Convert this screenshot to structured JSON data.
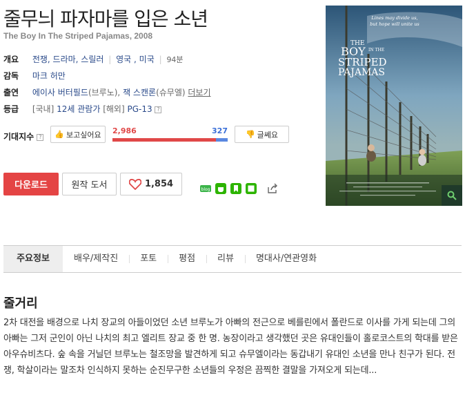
{
  "movie": {
    "title": "줄무늬 파자마를 입은 소년",
    "subtitle": "The Boy In The Striped Pajamas, 2008"
  },
  "info": {
    "overview_label": "개요",
    "genres": "전쟁, 드라마, 스릴러",
    "countries": "영국 , 미국",
    "runtime": "94분",
    "director_label": "감독",
    "director": "마크 허만",
    "cast_label": "출연",
    "cast_1": "에이사 버터필드",
    "cast_1_role": "(브루노),",
    "cast_2": "잭 스캔론",
    "cast_2_role": "(슈무엘)",
    "more_link": "더보기",
    "rating_label": "등급",
    "domestic_label": "[국내]",
    "domestic_rating": "12세 관람가",
    "overseas_label": "[해외]",
    "overseas_rating": "PG-13"
  },
  "expectation": {
    "label": "기대지수",
    "want_label": "보고싶어요",
    "dislike_label": "글쎄요",
    "want_count": "2,986",
    "dislike_count": "327",
    "want_ratio": 0.901
  },
  "actions": {
    "download": "다운로드",
    "book": "원작 도서",
    "likes": "1,854"
  },
  "poster": {
    "tagline_1": "Lines may divide us,",
    "tagline_2": "but hope will unite us",
    "title_1": "THE",
    "title_2": "BOY",
    "title_3": "IN THE",
    "title_4": "STRIPED",
    "title_5": "PAJAMAS"
  },
  "tabs": [
    "주요정보",
    "배우/제작진",
    "포토",
    "평점",
    "리뷰",
    "명대사/연관영화"
  ],
  "synopsis": {
    "title": "줄거리",
    "text": "2차 대전을 배경으로 나치 장교의 아들이었던 소년 브루노가 아빠의 전근으로 베를린에서 폴란드로 이사를 가게 되는데 그의 아빠는 그저 군인이 아닌 나치의 최고 엘리트 장교 중 한 명. 농장이라고 생각했던 곳은 유대인들이 홀로코스트의 학대를 받은 아우슈비츠다. 숲 속을 거닐던 브루노는 철조망을 발견하게 되고 슈무엘이라는 동갑내기 유대인 소년을 만나 친구가 된다. 전쟁, 학살이라는 말조차 인식하지 못하는 순진무구한 소년들의 우정은 끔찍한 결말을 가져오게 되는데..."
  },
  "colors": {
    "accent_red": "#e44444",
    "link_blue": "#2a4a8a",
    "bar_blue": "#5a88e0"
  }
}
